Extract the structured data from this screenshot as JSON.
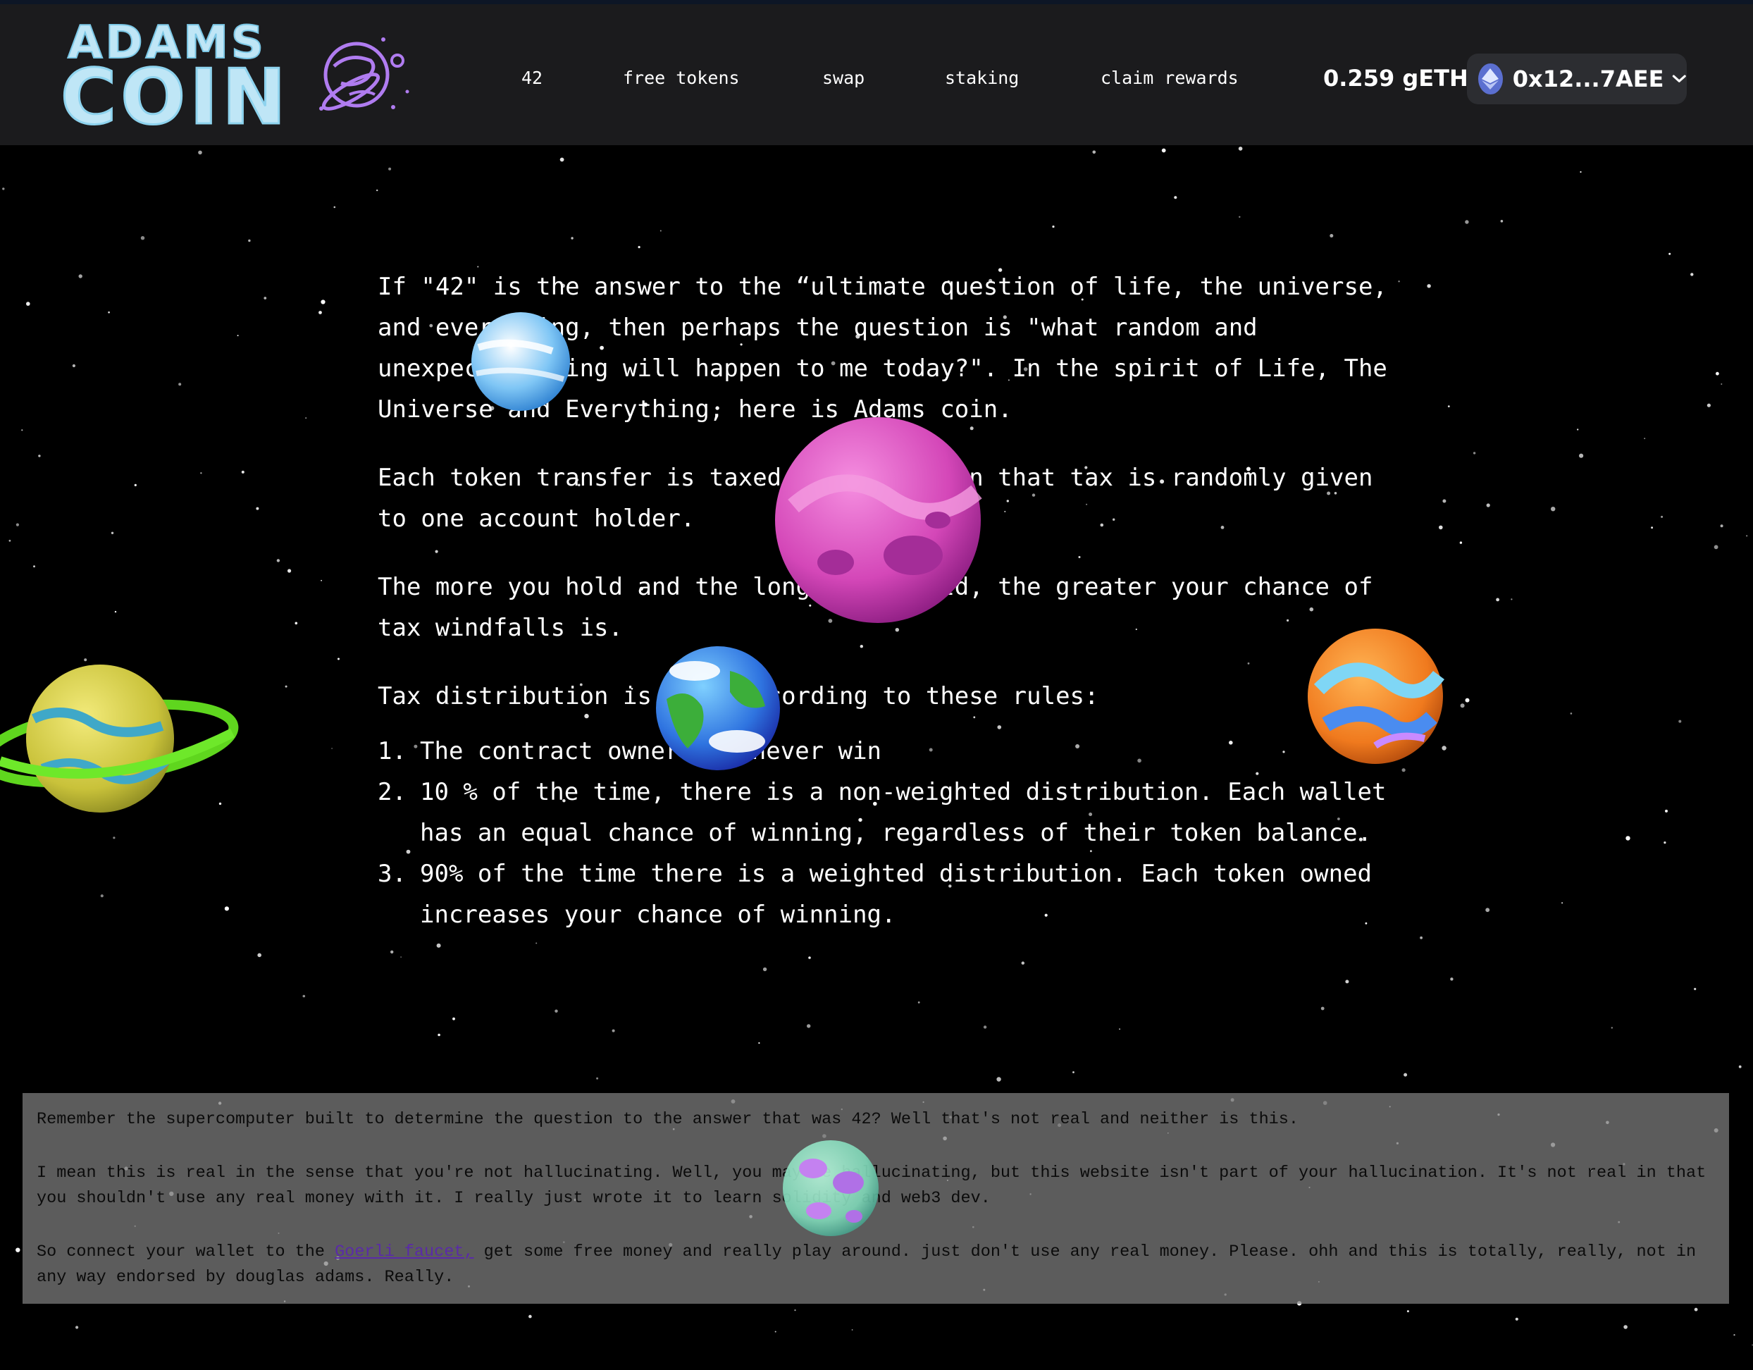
{
  "header": {
    "logo_line1": "ADAMS",
    "logo_line2": "COIN",
    "nav": [
      {
        "label": "42"
      },
      {
        "label": "free tokens"
      },
      {
        "label": "swap"
      },
      {
        "label": "staking"
      },
      {
        "label": "claim rewards"
      }
    ],
    "balance": "0.259 gETH",
    "wallet_address": "0x12...7AEE",
    "wallet_icon": "ethereum-icon",
    "chevron_icon": "chevron-down-icon"
  },
  "intro": {
    "paragraph1": "If \"42\" is the answer to the “ultimate question of life, the universe, and everything, then perhaps the question is \"what random and unexpected thing will happen to me today?\". In the spirit of Life, The Universe and Everything, here is Adams coin.",
    "paragraph2": "Each token transfer is taxed .42% and then that tax is randomly given to one account holder.",
    "paragraph3": "The more you hold and the longer you hold, the greater your chance of tax windfalls is.",
    "rules_heading": "Tax distribution is done according to these rules:",
    "rules": [
      {
        "num": "1.",
        "text": "The contract owner can never win"
      },
      {
        "num": "2.",
        "text": "10 % of the time, there is a non-weighted distribution. Each wallet has an equal chance of winning, regardless of their token balance."
      },
      {
        "num": "3.",
        "text": "90% of the time there is a weighted distribution. Each token owned increases your chance of winning."
      }
    ]
  },
  "disclaimer": {
    "paragraph1": "Remember the supercomputer built to determine the question to the answer that was 42? Well that's not real and neither is this.",
    "paragraph2": "I mean this is real in the sense that you're not hallucinating. Well, you may be hallucinating, but this website isn't part of your hallucination. It's not real in that you shouldn't use any real money with it. I really just wrote it to learn solidity and web3 dev.",
    "paragraph3_before": "So connect your wallet to the ",
    "faucet_link": "Goerli faucet,",
    "paragraph3_after": " get some free money and really play around. just don't use any real money. Please. ohh and this is totally, really, not in any way endorsed by douglas adams. Really."
  },
  "colors": {
    "background": "#000000",
    "header_bg": "#1b1b1d",
    "wallet_bg": "#2c2d31",
    "logo": "#bfe6f6",
    "logo_planet": "#b07cf0",
    "disclaimer_bg": "#808080",
    "link": "#5a2aa8"
  },
  "planets": [
    "ringed-yellow-planet-icon",
    "ice-planet-icon",
    "pink-planet-icon",
    "earth-planet-icon",
    "orange-swirl-planet-icon",
    "crystal-planet-icon"
  ]
}
